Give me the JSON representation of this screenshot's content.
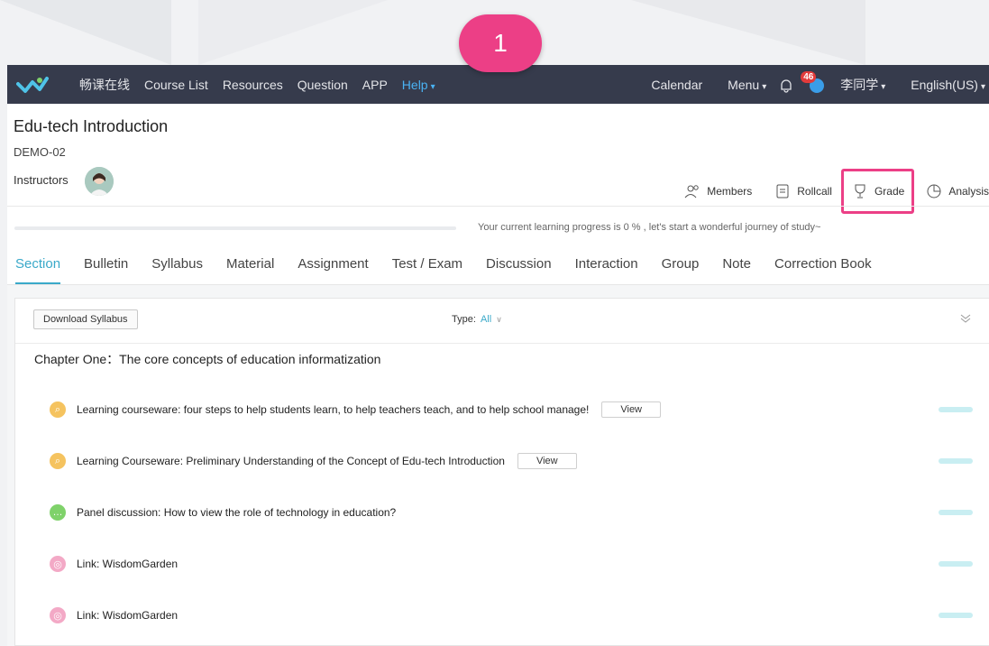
{
  "step_badge": "1",
  "nav": {
    "site_name": "畅课在线",
    "links": [
      "Course List",
      "Resources",
      "Question",
      "APP"
    ],
    "help_label": "Help",
    "right": {
      "calendar": "Calendar",
      "menu": "Menu",
      "notification_count": "46",
      "username": "李同学",
      "language": "English(US)"
    }
  },
  "course": {
    "title": "Edu-tech Introduction",
    "code": "DEMO-02",
    "instructors_label": "Instructors"
  },
  "actions": {
    "members": "Members",
    "rollcall": "Rollcall",
    "grade": "Grade",
    "analysis": "Analysis"
  },
  "progress": {
    "percent": 0,
    "text": "Your current learning progress is 0 % , let's start a wonderful journey of study~"
  },
  "tabs": [
    "Section",
    "Bulletin",
    "Syllabus",
    "Material",
    "Assignment",
    "Test / Exam",
    "Discussion",
    "Interaction",
    "Group",
    "Note",
    "Correction Book"
  ],
  "active_tab": "Section",
  "section": {
    "download_label": "Download Syllabus",
    "type_label": "Type:",
    "type_value": "All",
    "chapter_title": "Chapter One：The core concepts of education informatization",
    "view_label": "View",
    "items": [
      {
        "type": "courseware",
        "text": "Learning courseware: four steps to help students learn, to help teachers teach, and to help school manage!",
        "has_view": true
      },
      {
        "type": "courseware",
        "text": "Learning Courseware: Preliminary Understanding of the Concept of Edu-tech Introduction",
        "has_view": true
      },
      {
        "type": "discussion",
        "text": "Panel discussion: How to view the role of technology in education?",
        "has_view": false
      },
      {
        "type": "link",
        "text": "Link: WisdomGarden",
        "has_view": false
      },
      {
        "type": "link",
        "text": "Link: WisdomGarden",
        "has_view": false
      }
    ]
  },
  "colors": {
    "nav_bg": "#363b4c",
    "accent": "#3aa9c9",
    "highlight": "#ec3f86",
    "help_link": "#4ab3f4"
  }
}
